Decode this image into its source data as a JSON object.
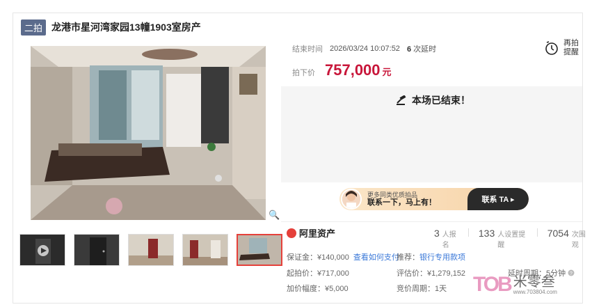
{
  "header": {
    "tag": "二拍",
    "title": "龙港市星河湾家园13幢1903室房产"
  },
  "auction": {
    "end_label": "结束时间",
    "end_time": "2026/03/24 10:07:52",
    "delay_count": "6",
    "delay_label": "次延时",
    "remind_line1": "再拍",
    "remind_line2": "提醒",
    "price_label": "拍下价",
    "price": "757,000",
    "price_unit": "元",
    "ended_text": "本场已结束！"
  },
  "banner": {
    "line1": "更多同类优质拍品",
    "line2": "联系一下，马上有！",
    "button": "联系 TA ▸"
  },
  "platform": {
    "name": "阿里资产"
  },
  "stats": [
    {
      "value": "3",
      "label": "人报名"
    },
    {
      "value": "133",
      "label": "人设置提醒"
    },
    {
      "value": "7054",
      "label": "次围观"
    }
  ],
  "details": {
    "deposit": "保证金：¥140,000",
    "deposit_link": "查看如何支付",
    "recommend": "推荐：",
    "recommend_link": "银行专用款项",
    "start_price": "起拍价：¥717,000",
    "assess": "评估价：¥1,279,152",
    "delay_period": "延时周期：5分钟",
    "increment": "加价幅度：¥5,000",
    "bid_period": "竞价周期：1天"
  },
  "watermark": {
    "brand": "TOB",
    "name": "米零叁",
    "url": "www.703804.com"
  }
}
